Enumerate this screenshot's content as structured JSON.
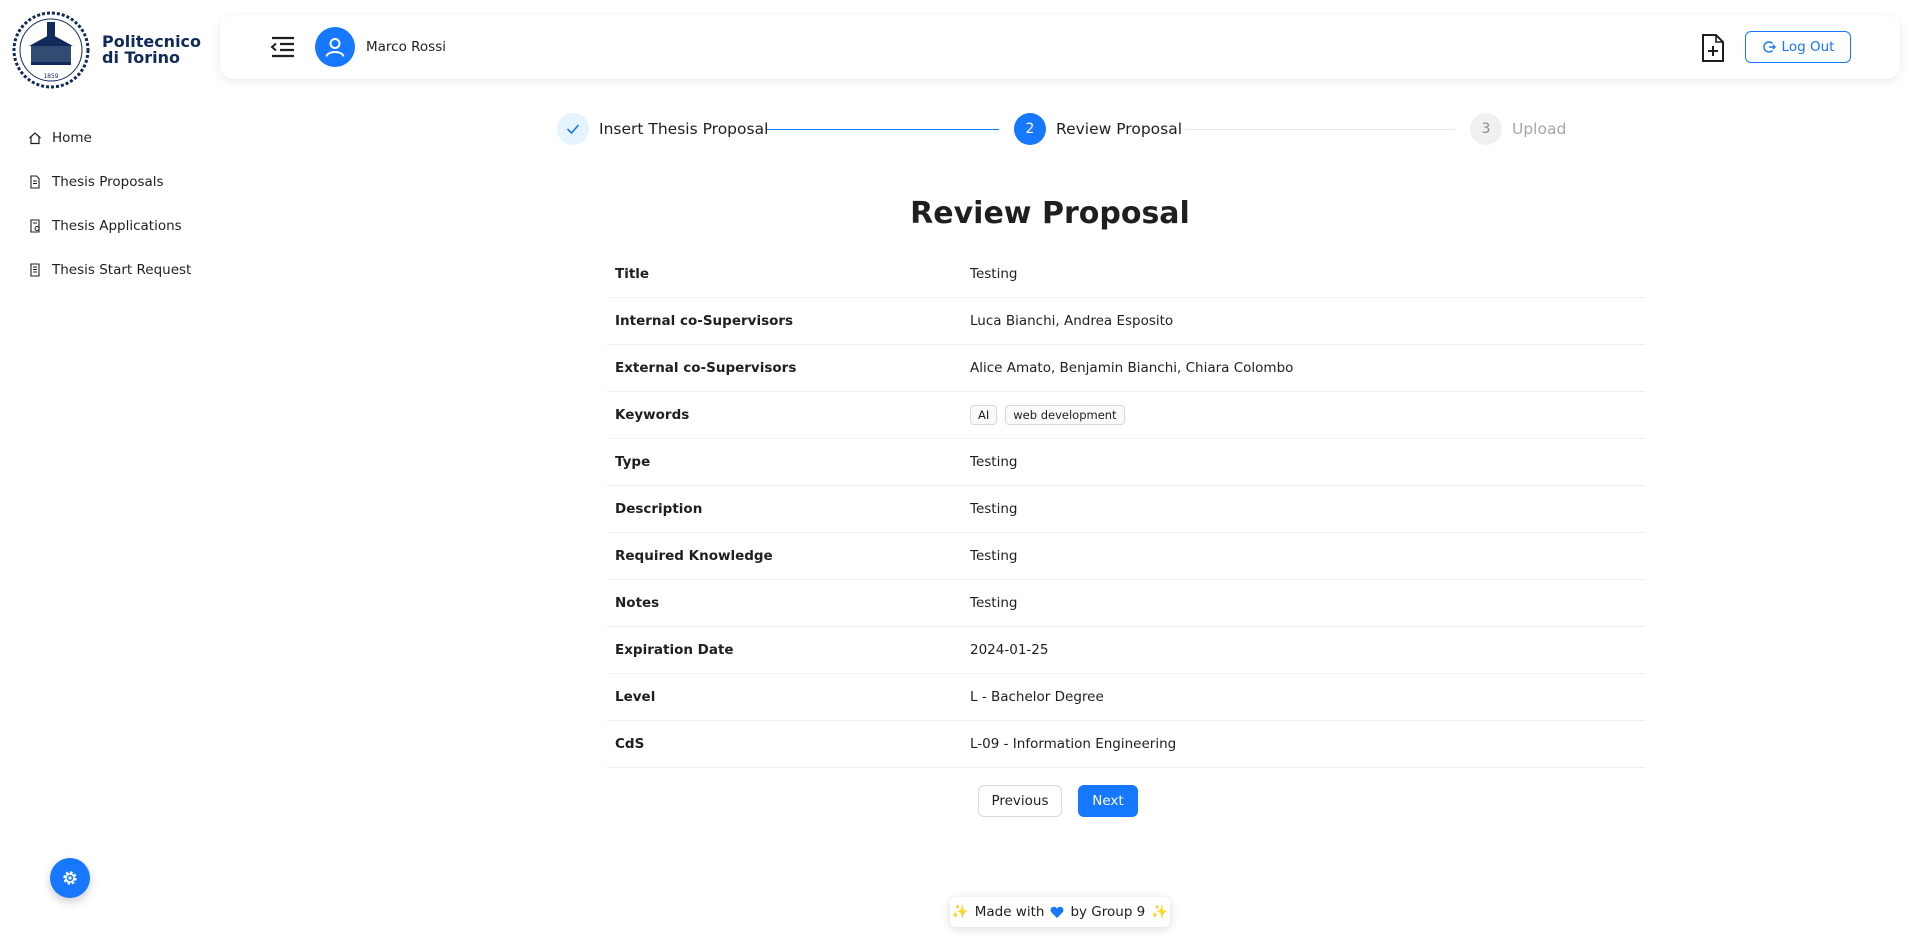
{
  "logo": {
    "line1": "Politecnico",
    "line2": "di Torino"
  },
  "sidebar": {
    "items": [
      {
        "label": "Home",
        "icon": "home-icon"
      },
      {
        "label": "Thesis Proposals",
        "icon": "document-icon"
      },
      {
        "label": "Thesis Applications",
        "icon": "document-check-icon"
      },
      {
        "label": "Thesis Start Request",
        "icon": "document-list-icon"
      }
    ]
  },
  "header": {
    "user_name": "Marco Rossi",
    "logout_label": "Log Out"
  },
  "steps": [
    {
      "label": "Insert Thesis Proposal",
      "state": "done"
    },
    {
      "number": "2",
      "label": "Review Proposal",
      "state": "active"
    },
    {
      "number": "3",
      "label": "Upload",
      "state": "pending"
    }
  ],
  "review": {
    "title": "Review Proposal",
    "rows": [
      {
        "key": "Title",
        "value": "Testing"
      },
      {
        "key": "Internal co-Supervisors",
        "value": "Luca Bianchi, Andrea Esposito"
      },
      {
        "key": "External co-Supervisors",
        "value": "Alice Amato, Benjamin Bianchi, Chiara Colombo"
      },
      {
        "key": "Keywords",
        "tags": [
          "AI",
          "web development"
        ]
      },
      {
        "key": "Type",
        "value": "Testing"
      },
      {
        "key": "Description",
        "value": "Testing"
      },
      {
        "key": "Required Knowledge",
        "value": "Testing"
      },
      {
        "key": "Notes",
        "value": "Testing"
      },
      {
        "key": "Expiration Date",
        "value": "2024-01-25"
      },
      {
        "key": "Level",
        "value": "L - Bachelor Degree"
      },
      {
        "key": "CdS",
        "value": "L-09 - Information Engineering"
      }
    ]
  },
  "buttons": {
    "previous": "Previous",
    "next": "Next"
  },
  "footer": {
    "prefix": "Made with",
    "suffix": "by Group 9"
  },
  "colors": {
    "accent": "#1677ff",
    "brand": "#0f2a5b"
  }
}
